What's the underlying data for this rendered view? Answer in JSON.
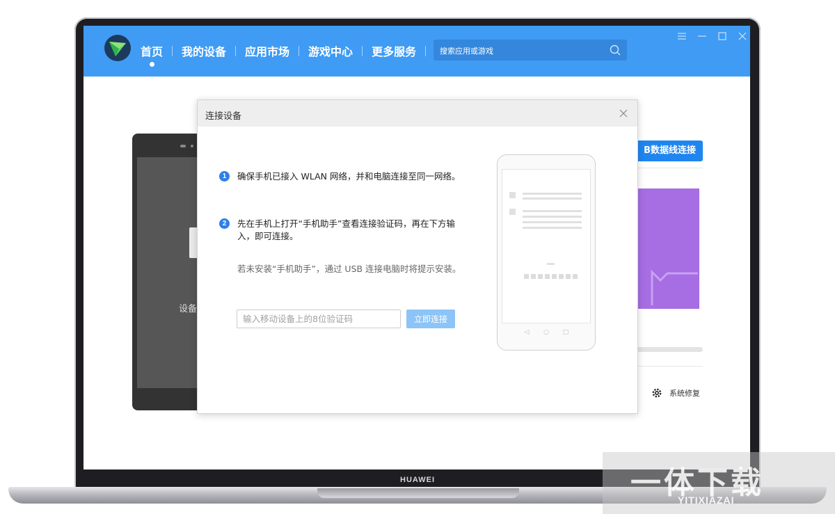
{
  "app": {
    "nav": [
      {
        "label": "首页",
        "active": true
      },
      {
        "label": "我的设备"
      },
      {
        "label": "应用市场"
      },
      {
        "label": "游戏中心"
      },
      {
        "label": "更多服务"
      }
    ],
    "search": {
      "placeholder": "搜索应用或游戏"
    },
    "window_controls": [
      "menu-icon",
      "minimize-icon",
      "maximize-icon",
      "close-icon"
    ],
    "accent_color": "#3f9bf4"
  },
  "background": {
    "device_label": "设备",
    "usb_button": "B数据线连接",
    "system_repair": "系统修复",
    "banner_color": "#a76de3"
  },
  "dialog": {
    "title": "连接设备",
    "steps": [
      {
        "num": "1",
        "text": "确保手机已接入 WLAN 网络，并和电脑连接至同一网络。"
      },
      {
        "num": "2",
        "text": "先在手机上打开“手机助手”查看连接验证码，再在下方输入，即可连接。"
      }
    ],
    "note": "若未安装“手机助手”，通过 USB 连接电脑时将提示安装。",
    "code_input": {
      "placeholder": "输入移动设备上的8位验证码",
      "value": ""
    },
    "connect_button": "立即连接"
  },
  "laptop": {
    "brand": "HUAWEI"
  },
  "watermark": {
    "text": "一体下载",
    "sub": "YITIXIAZAI"
  }
}
